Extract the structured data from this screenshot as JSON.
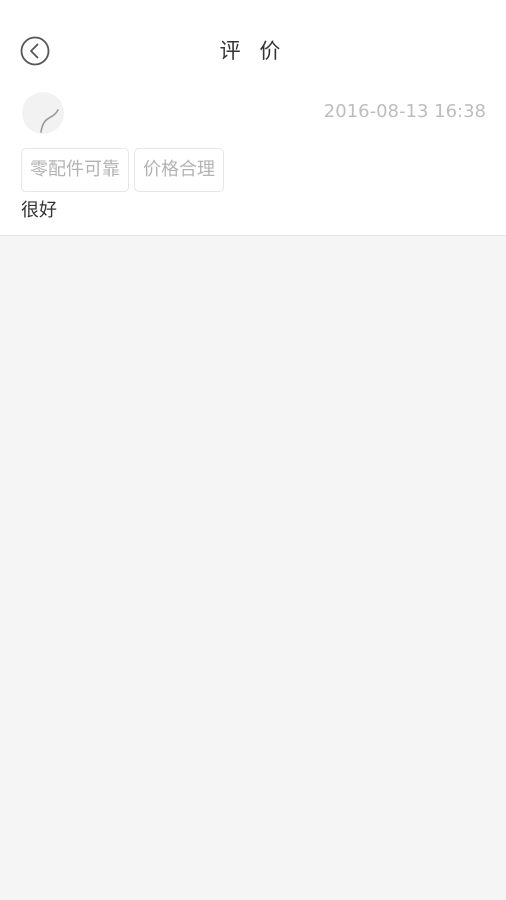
{
  "header": {
    "title": "评 价",
    "back_icon": "chevron-left-circle-icon"
  },
  "review": {
    "avatar_icon": "default-avatar-icon",
    "timestamp": "2016-08-13 16:38",
    "tags": [
      "零配件可靠",
      "价格合理"
    ],
    "content": "很好"
  },
  "colors": {
    "header_bg": "#ffffff",
    "page_bg": "#f5f5f5",
    "tag_border": "#e6e6e6",
    "muted_text": "#bdbdbd",
    "body_text": "#333333"
  }
}
